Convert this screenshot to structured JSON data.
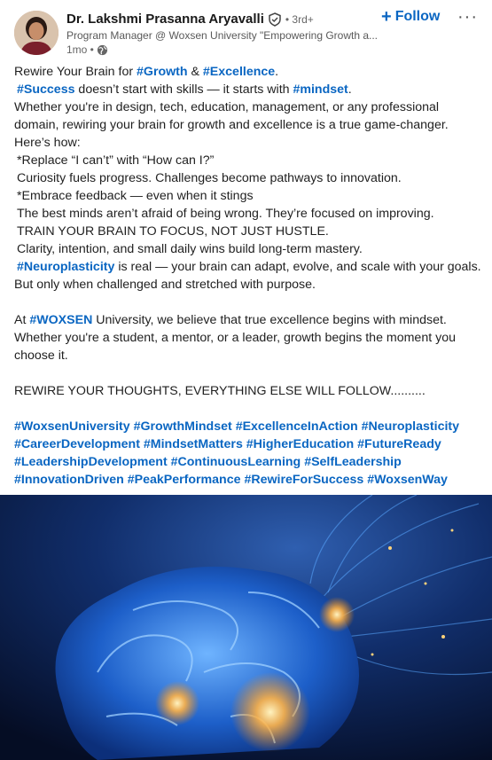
{
  "author": {
    "name": "Dr. Lakshmi Prasanna Aryavalli",
    "degree": "• 3rd+",
    "headline": "Program Manager @ Woxsen University \"Empowering Growth a...",
    "time": "1mo •",
    "follow_label": "Follow",
    "more_label": "···"
  },
  "post": {
    "l1_a": "Rewire Your Brain for ",
    "l1_t1": "#Growth",
    "l1_b": " & ",
    "l1_t2": "#Excellence",
    "l1_c": ".",
    "l2_t1": "#Success",
    "l2_a": " doesn’t start with skills — it starts with ",
    "l2_t2": "#mindset",
    "l2_b": ".",
    "l3": "Whether you're in design, tech, education, management, or any professional",
    "l4": "domain, rewiring your brain for growth and excellence is a true game-changer.",
    "l5": "Here’s how:",
    "l6": "*Replace “I can’t” with “How can I?”",
    "l7": "Curiosity fuels progress. Challenges become pathways to innovation.",
    "l8": "*Embrace feedback — even when it stings",
    "l9": "The best minds aren’t afraid of being wrong. They’re focused on improving.",
    "l10": "TRAIN YOUR BRAIN TO FOCUS, NOT JUST HUSTLE.",
    "l11": "Clarity, intention, and small daily wins build long-term mastery.",
    "l12_t": "#Neuroplasticity",
    "l12_a": " is real — your brain can adapt, evolve, and scale with your goals.",
    "l13": "But only when challenged and stretched with purpose.",
    "l14_a": "At ",
    "l14_t": "#WOXSEN",
    "l14_b": " University, we believe that true excellence begins with mindset.",
    "l15": "Whether you're a student, a mentor, or a leader, growth begins the moment you",
    "l16": "choose it.",
    "l17": "REWIRE YOUR THOUGHTS, EVERYTHING ELSE WILL FOLLOW..........",
    "hashtags": [
      [
        "#WoxsenUniversity",
        "#GrowthMindset",
        "#ExcellenceInAction",
        "#Neuroplasticity"
      ],
      [
        "#CareerDevelopment",
        "#MindsetMatters",
        "#HigherEducation",
        "#FutureReady"
      ],
      [
        "#LeadershipDevelopment",
        "#ContinuousLearning",
        "#SelfLeadership"
      ],
      [
        "#InnovationDriven",
        "#PeakPerformance",
        "#RewireForSuccess",
        "#WoxsenWay"
      ]
    ]
  },
  "colors": {
    "link": "#0a66c2",
    "text": "#1f1f1f",
    "image_bg": "#0b1f4a"
  },
  "icons": {
    "verified": "verified-shield-icon",
    "globe": "globe-icon",
    "plus": "plus-icon",
    "more": "more-dots-icon"
  }
}
